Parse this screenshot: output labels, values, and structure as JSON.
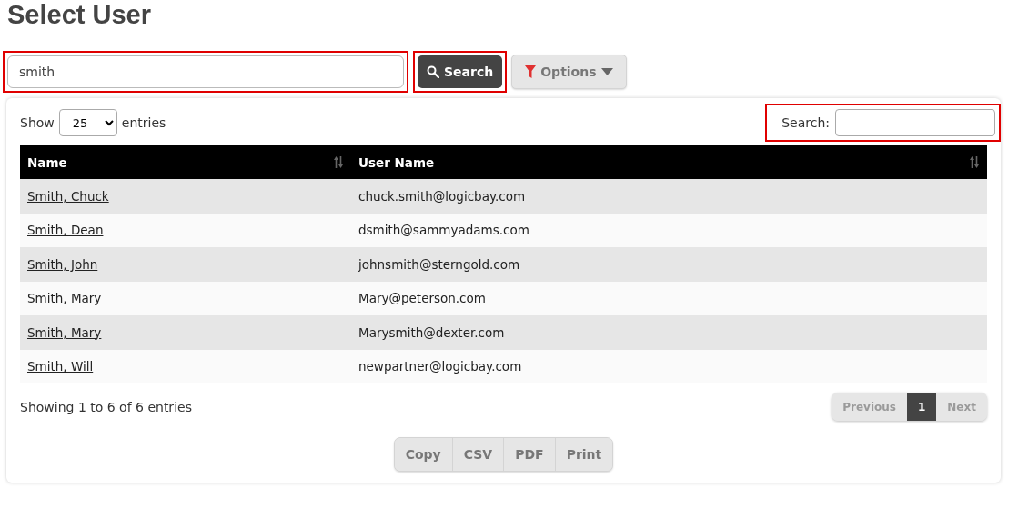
{
  "title": "Select User",
  "search_bar": {
    "value": "smith",
    "highlighted": true,
    "button": {
      "label": "Search",
      "highlighted": true
    },
    "options": {
      "label": "Options"
    }
  },
  "table_controls": {
    "show_label": "Show",
    "page_length": "25",
    "entries_label": "entries",
    "filter_label": "Search:",
    "filter_highlighted": true
  },
  "table": {
    "columns": [
      "Name",
      "User Name"
    ],
    "rows": [
      {
        "name": "Smith, Chuck",
        "user_name": "chuck.smith@logicbay.com"
      },
      {
        "name": "Smith, Dean",
        "user_name": "dsmith@sammyadams.com"
      },
      {
        "name": "Smith, John",
        "user_name": "johnsmith@sterngold.com"
      },
      {
        "name": "Smith, Mary",
        "user_name": "Mary@peterson.com"
      },
      {
        "name": "Smith, Mary",
        "user_name": "Marysmith@dexter.com"
      },
      {
        "name": "Smith, Will",
        "user_name": "newpartner@logicbay.com"
      }
    ]
  },
  "info": "Showing 1 to 6 of 6 entries",
  "pagination": [
    {
      "label": "Previous",
      "disabled": true,
      "selected": false
    },
    {
      "label": "1",
      "disabled": false,
      "selected": true
    },
    {
      "label": "Next",
      "disabled": true,
      "selected": false
    }
  ],
  "export_buttons": [
    "Copy",
    "CSV",
    "PDF",
    "Print"
  ]
}
